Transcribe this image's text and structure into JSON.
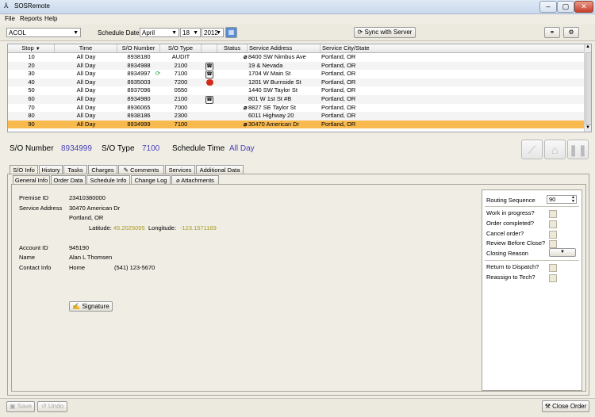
{
  "window": {
    "title": "SOSRemote",
    "controls": [
      "–",
      "▢",
      "✕"
    ]
  },
  "menu": [
    "File",
    "Reports",
    "Help"
  ],
  "toolbar": {
    "office": "ACOL",
    "schedule_date_label": "Schedule Date",
    "month": "April",
    "day": "18",
    "year": "2012",
    "sync_label": "Sync with Server"
  },
  "table": {
    "columns": [
      "Stop",
      "Time",
      "S/O Number",
      "S/O Type",
      "Status",
      "Service Address",
      "Service City/State"
    ],
    "sort_arrow": "▼",
    "rows": [
      {
        "stop": "10",
        "time": "All Day",
        "so": "8938180",
        "type": "AUDIT",
        "icon": "",
        "clip": "true",
        "addr": "8400 SW Nimbus Ave",
        "city": "Portland, OR"
      },
      {
        "stop": "20",
        "time": "All Day",
        "so": "8934988",
        "type": "2100",
        "icon": "phone",
        "clip": "",
        "addr": "19 & Nevada",
        "city": "Portland, OR"
      },
      {
        "stop": "30",
        "time": "All Day",
        "so": "8934997",
        "type": "7100",
        "icon": "phone",
        "clip": "",
        "addr": "1704 W Main St",
        "city": "Portland, OR",
        "sync": "true"
      },
      {
        "stop": "40",
        "time": "All Day",
        "so": "8935003",
        "type": "7200",
        "icon": "stop",
        "clip": "",
        "addr": "1201 W Burnside St",
        "city": "Portland, OR"
      },
      {
        "stop": "50",
        "time": "All Day",
        "so": "8937096",
        "type": "0550",
        "icon": "",
        "clip": "",
        "addr": "1440 SW Taylor St",
        "city": "Portland, OR"
      },
      {
        "stop": "60",
        "time": "All Day",
        "so": "8934980",
        "type": "2100",
        "icon": "phone",
        "clip": "",
        "addr": "801 W 1st St #B",
        "city": "Portland, OR"
      },
      {
        "stop": "70",
        "time": "All Day",
        "so": "8936065",
        "type": "7000",
        "icon": "",
        "clip": "true",
        "addr": "8827 SE Taylor St",
        "city": "Portland, OR"
      },
      {
        "stop": "80",
        "time": "All Day",
        "so": "8938186",
        "type": "2300",
        "icon": "",
        "clip": "",
        "addr": "6011 Highway 20",
        "city": "Portland, OR"
      },
      {
        "stop": "90",
        "time": "All Day",
        "so": "8934999",
        "type": "7100",
        "icon": "",
        "clip": "true",
        "addr": "30470 American Dr",
        "city": "Portland, OR"
      }
    ],
    "selected_index": 8
  },
  "detail": {
    "so_number_label": "S/O Number",
    "so_number": "8934999",
    "so_type_label": "S/O Type",
    "so_type": "7100",
    "schedule_time_label": "Schedule Time",
    "schedule_time": "All Day"
  },
  "tabs": [
    "S/O Info",
    "History",
    "Tasks",
    "Charges",
    "Comments",
    "Services",
    "Additional Data"
  ],
  "subtabs": [
    "General Info",
    "Order Data",
    "Schedule Info",
    "Change Log",
    "Attachments"
  ],
  "general": {
    "premise_id_label": "Premise ID",
    "premise_id": "23410380000",
    "service_address_label": "Service Address",
    "address1": "30470 American Dr",
    "address2": "Portland, OR",
    "latitude_label": "Latitude:",
    "latitude": "45.2025095",
    "longitude_label": "Longitude:",
    "longitude": "-123.1571169",
    "account_id_label": "Account ID",
    "account_id": "945190",
    "name_label": "Name",
    "name": "Alan L Thomsen",
    "contact_label": "Contact Info",
    "contact_type": "Home",
    "contact_phone": "(541) 123-5670",
    "signature_label": "Signature"
  },
  "right_panel": {
    "routing_sequence_label": "Routing Sequence",
    "routing_sequence": "90",
    "checks": [
      "Work in progress?",
      "Order completed?",
      "Cancel order?",
      "Review Before Close?"
    ],
    "closing_reason_label": "Closing Reason",
    "checks2": [
      "Return to Dispatch?",
      "Reassign to Tech?"
    ]
  },
  "status_bar": {
    "save": "Save",
    "undo": "Undo",
    "close_order": "Close Order"
  }
}
